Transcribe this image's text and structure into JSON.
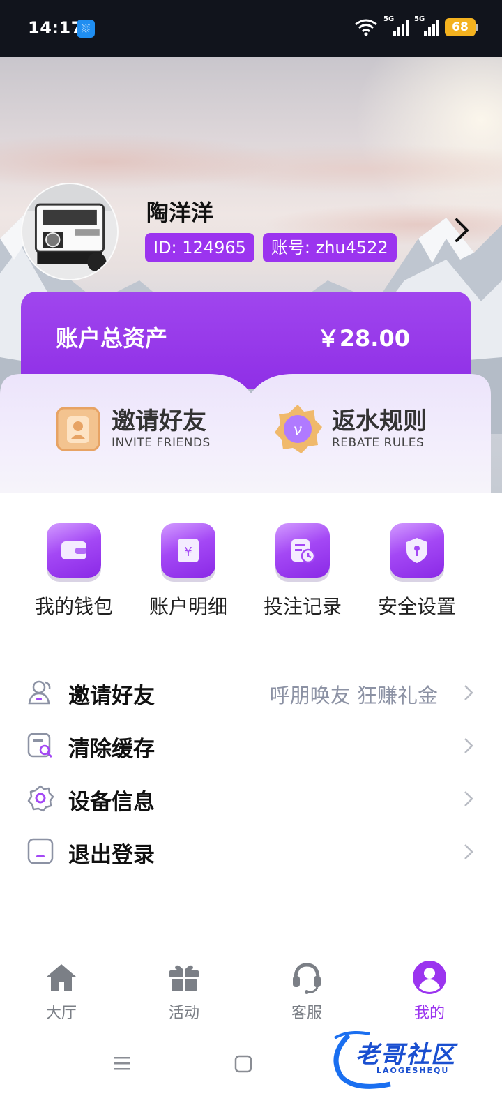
{
  "status_bar": {
    "time": "14:17",
    "battery": "68",
    "network_1": "5G",
    "network_2": "5G"
  },
  "profile": {
    "name": "陶洋洋",
    "id_badge": "ID: 124965",
    "account_badge": "账号: zhu4522"
  },
  "assets": {
    "label": "账户总资产",
    "value": "￥28.00"
  },
  "quick_actions": [
    {
      "title": "邀请好友",
      "subtitle": "INVITE FRIENDS"
    },
    {
      "title": "返水规则",
      "subtitle": "REBATE  RULES"
    }
  ],
  "shortcuts": [
    {
      "label": "我的钱包",
      "icon": "wallet-icon"
    },
    {
      "label": "账户明细",
      "icon": "yuan-receipt-icon"
    },
    {
      "label": "投注记录",
      "icon": "record-clock-icon"
    },
    {
      "label": "安全设置",
      "icon": "shield-icon"
    }
  ],
  "menu": [
    {
      "label": "邀请好友",
      "extra": "呼朋唤友 狂赚礼金",
      "icon": "users-icon"
    },
    {
      "label": "清除缓存",
      "extra": "",
      "icon": "clear-cache-icon"
    },
    {
      "label": "设备信息",
      "extra": "",
      "icon": "gear-icon"
    },
    {
      "label": "退出登录",
      "extra": "",
      "icon": "logout-icon"
    }
  ],
  "tabs": [
    {
      "label": "大厅",
      "icon": "home-icon",
      "active": false
    },
    {
      "label": "活动",
      "icon": "gift-icon",
      "active": false
    },
    {
      "label": "客服",
      "icon": "headset-icon",
      "active": false
    },
    {
      "label": "我的",
      "icon": "user-icon",
      "active": true
    }
  ],
  "watermark": {
    "text": "老哥社区",
    "sub": "LAOGESHEQU"
  },
  "colors": {
    "accent": "#9b34ef",
    "status_bar": "#11141c",
    "battery": "#f4b21f",
    "muted_text": "#8c92a4"
  }
}
